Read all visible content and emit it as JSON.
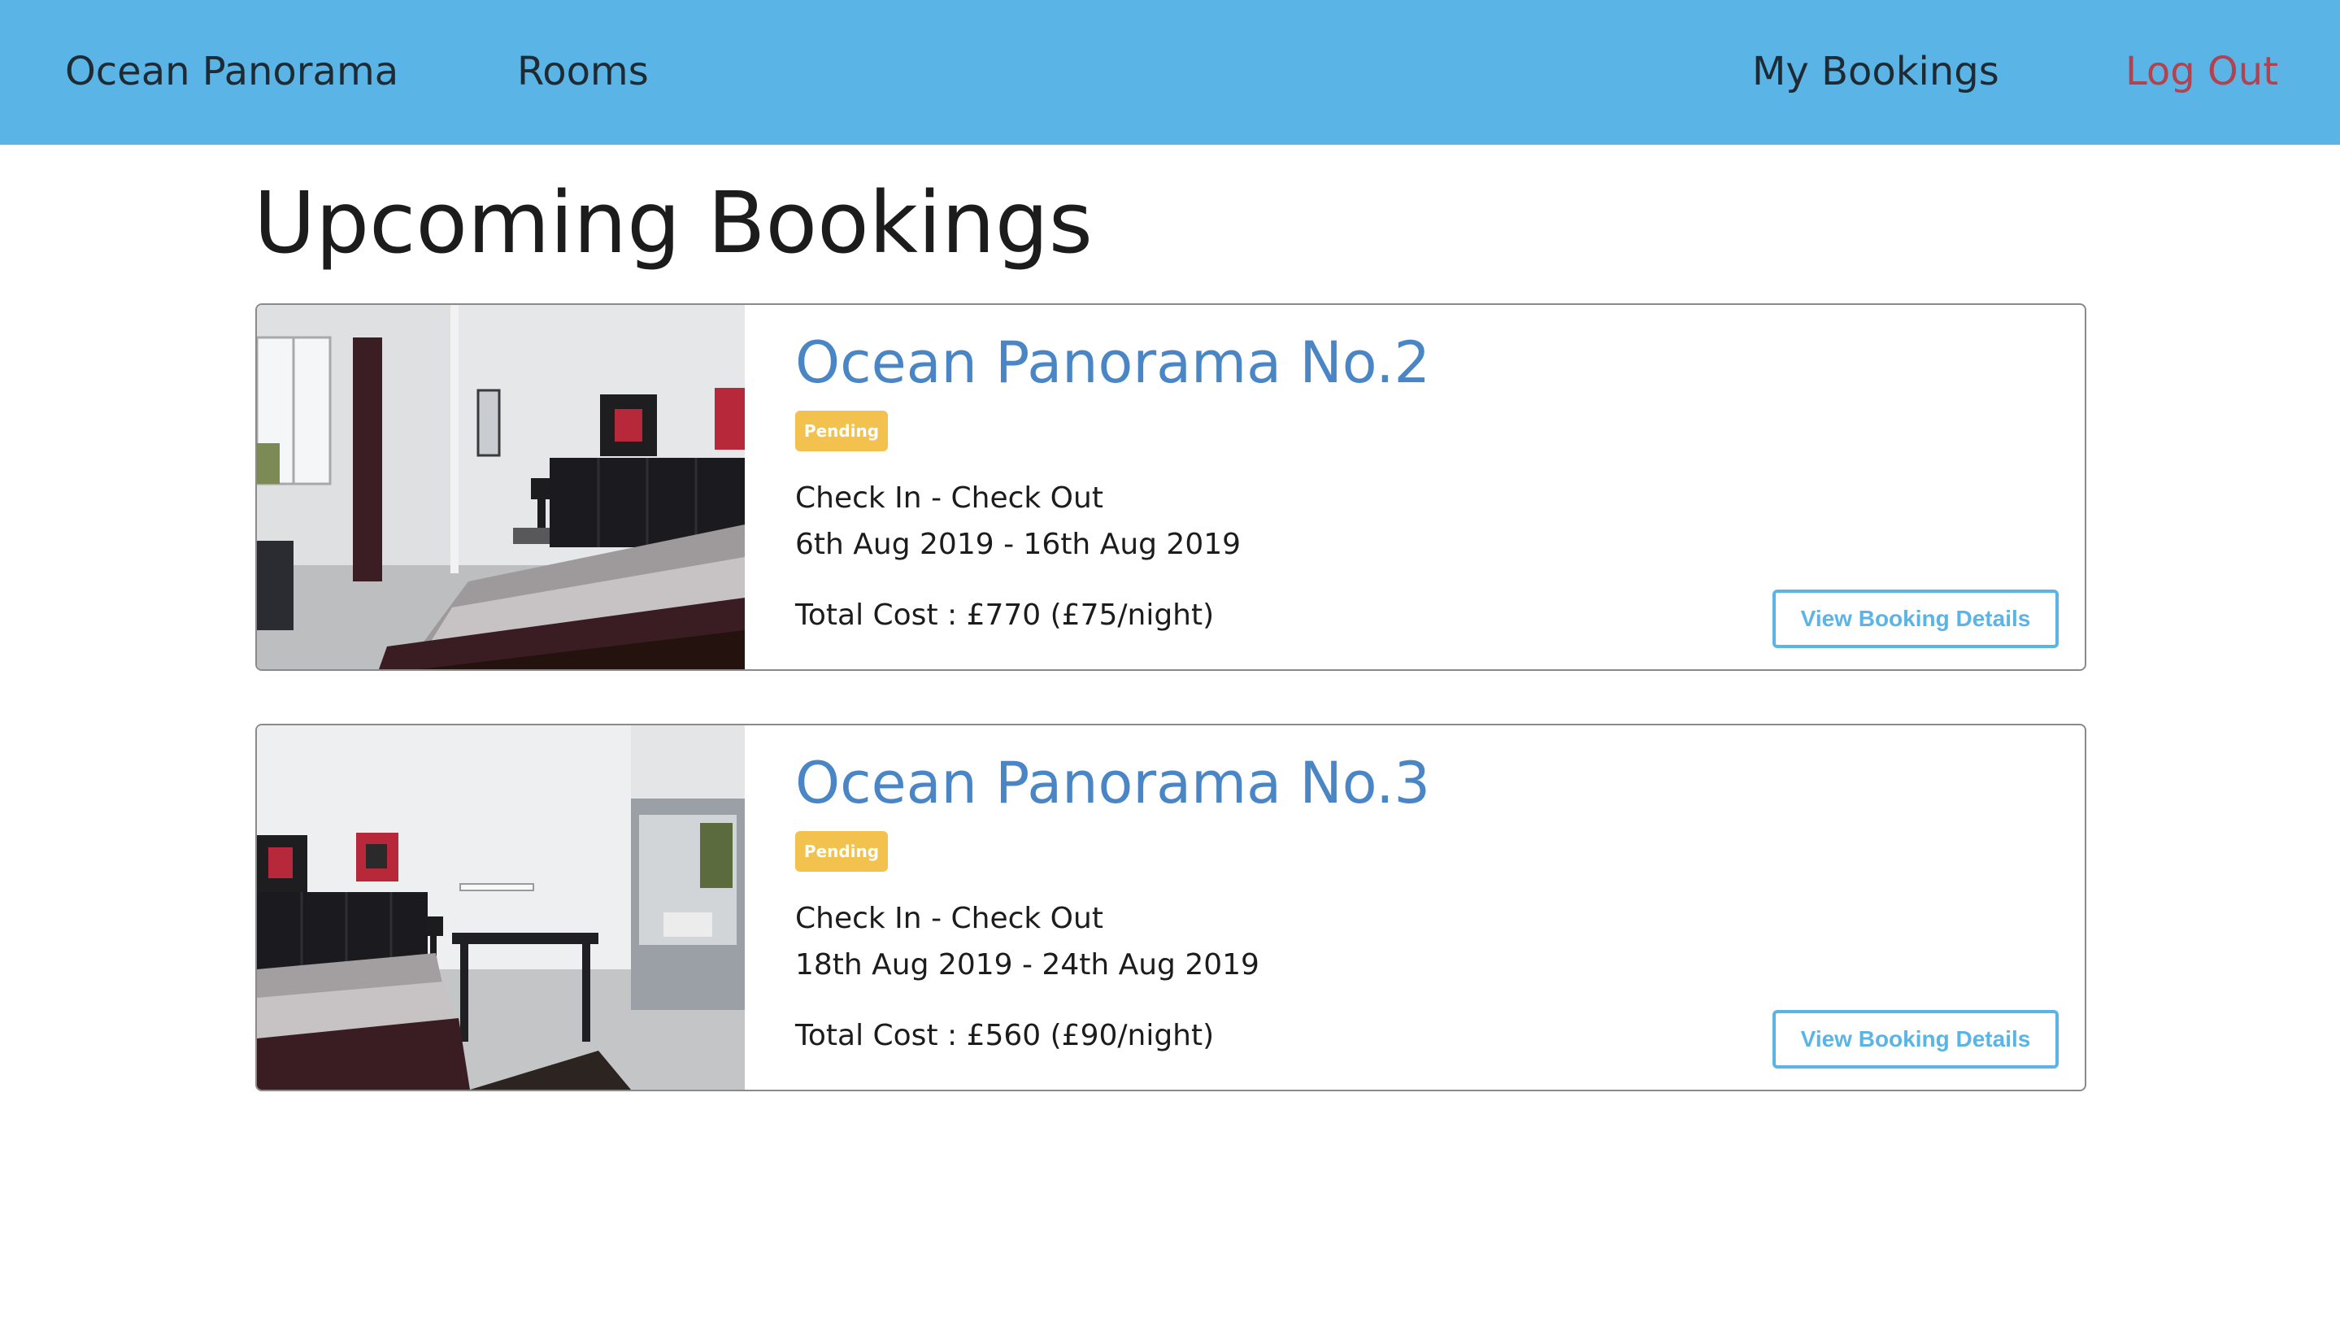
{
  "colors": {
    "navbar_bg": "#5ab4e6",
    "logout": "#b3424f",
    "room_title": "#4a86c5",
    "badge_pending": "#f2c14e",
    "button_accent": "#5ab4e6"
  },
  "nav": {
    "brand": "Ocean Panorama",
    "rooms": "Rooms",
    "my_bookings": "My Bookings",
    "log_out": "Log Out"
  },
  "page": {
    "title": "Upcoming Bookings"
  },
  "bookings": [
    {
      "room_name": "Ocean Panorama No.2",
      "status": "Pending",
      "dates_label": "Check In - Check Out",
      "dates": "6th Aug 2019 - 16th Aug 2019",
      "total_cost": "Total Cost : £770 (£75/night)",
      "button_label": "View Booking Details",
      "photo_icon": "bedroom-photo"
    },
    {
      "room_name": "Ocean Panorama No.3",
      "status": "Pending",
      "dates_label": "Check In - Check Out",
      "dates": "18th Aug 2019 - 24th Aug 2019",
      "total_cost": "Total Cost : £560 (£90/night)",
      "button_label": "View Booking Details",
      "photo_icon": "bedroom-photo"
    }
  ]
}
